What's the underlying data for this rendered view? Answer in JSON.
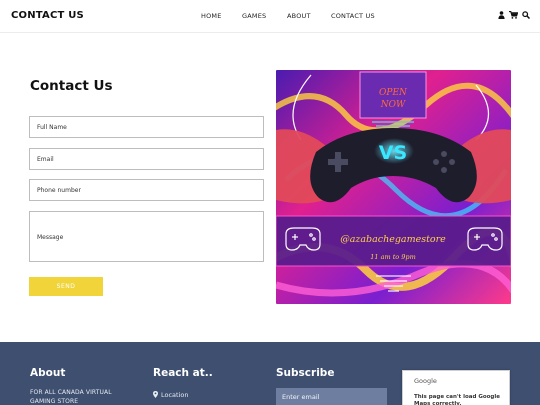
{
  "header": {
    "brand": "CONTACT US",
    "nav": [
      "HOME",
      "GAMES",
      "ABOUT",
      "CONTACT US"
    ],
    "icons": [
      "user-icon",
      "cart-icon",
      "search-icon"
    ]
  },
  "contact": {
    "title": "Contact Us",
    "fields": {
      "full_name": "Full Name",
      "email": "Email",
      "phone": "Phone number",
      "message": "Message"
    },
    "send_label": "SEND"
  },
  "promo": {
    "sign": [
      "OPEN",
      "NOW"
    ],
    "vs": "VS",
    "handle": "@azabachegamestore",
    "hours": "11 am to 9pm"
  },
  "footer": {
    "about_title": "About",
    "about_text": "FOR ALL CANADA VIRTUAL GAMING STORE",
    "reach_title": "Reach at..",
    "location_label": "Location",
    "subscribe_title": "Subscribe",
    "email_placeholder": "Enter email",
    "map_logo": "Google",
    "map_error": "This page can't load Google Maps correctly."
  },
  "colors": {
    "accent_yellow": "#f0d43a",
    "footer_bg": "#3e4f70",
    "input_bg": "#6e7ea0"
  }
}
